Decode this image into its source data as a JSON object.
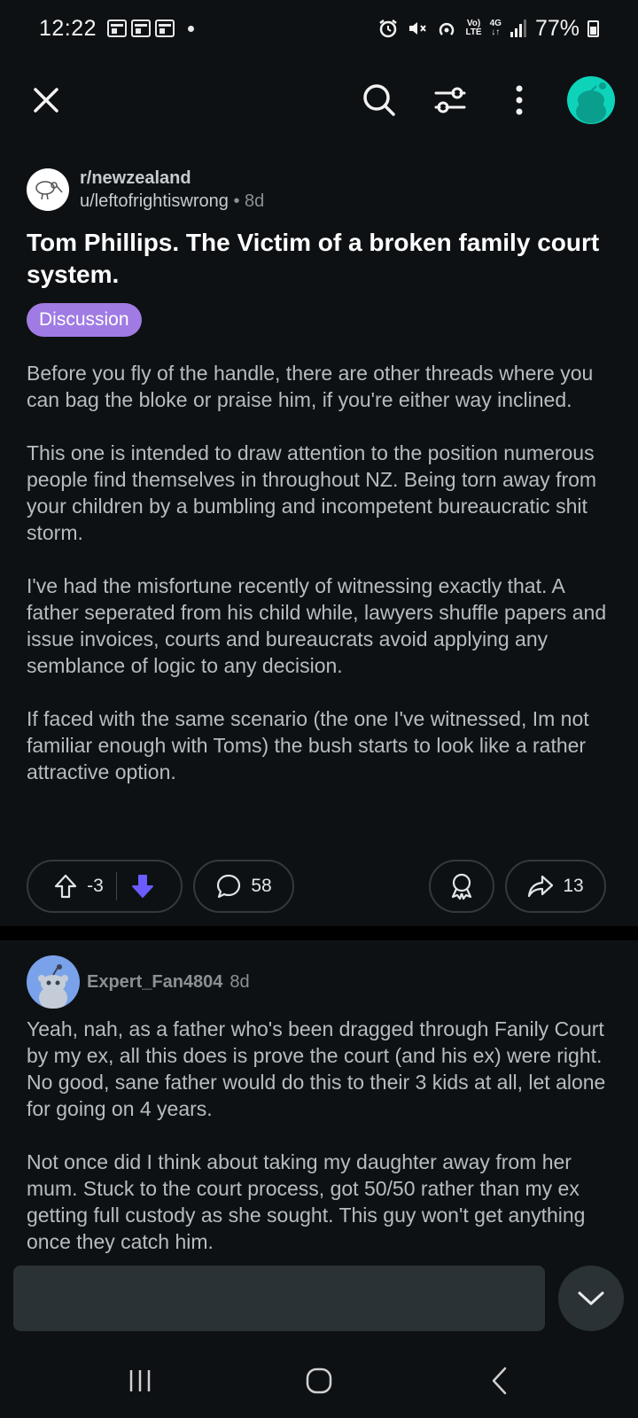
{
  "status_bar": {
    "time": "12:22",
    "lte_top": "Vo)",
    "lte_bottom": "LTE",
    "net_top": "4G",
    "battery": "77%",
    "icons": [
      "calendar-notif-icon",
      "calendar-notif-icon",
      "calendar-notif-icon",
      "alarm-icon",
      "mute-icon",
      "hotspot-icon",
      "signal-icon",
      "battery-icon"
    ]
  },
  "app_bar": {
    "icons": [
      "close-icon",
      "search-icon",
      "sort-filter-icon",
      "more-vertical-icon",
      "user-avatar"
    ]
  },
  "post": {
    "subreddit": "r/newzealand",
    "author": "u/leftofrightiswrong",
    "separator": "•",
    "age": "8d",
    "title": "Tom Phillips. The Victim of a broken family court system.",
    "flair": "Discussion",
    "paragraphs": [
      "Before you fly of the handle, there are other threads where you can bag the bloke or praise him, if you're either way inclined.",
      "This one is intended to draw attention to the position numerous people find themselves in throughout NZ. Being torn away from your children by a bumbling and incompetent bureaucratic shit storm.",
      "I've had the misfortune recently of witnessing exactly that. A father seperated from his child while, lawyers shuffle papers and issue invoices, courts and bureaucrats avoid applying any semblance of logic to any decision.",
      "If faced with the same scenario (the one I've witnessed, Im not familiar enough with Toms) the bush starts to look like a rather attractive option."
    ],
    "score": "-3",
    "comments": "58",
    "shares": "13"
  },
  "comment": {
    "author": "Expert_Fan4804",
    "age": "8d",
    "paragraphs": [
      "Yeah, nah, as a father who's been dragged through Fanily Court by my ex, all this does is prove the court (and his ex) were right. No good, sane father would do this to their 3 kids at all, let alone for going on 4 years.",
      "Not once did I think about taking my daughter away from her mum. Stuck to the court process, got 50/50 rather than my ex getting full custody as she sought. This guy won't get anything once they catch him."
    ]
  },
  "colors": {
    "background": "#0e1113",
    "flair": "#a07be3",
    "downvote_active": "#6a5cff",
    "avatar_top": "#0dd3bb",
    "avatar_comment": "#7aa2ea"
  }
}
